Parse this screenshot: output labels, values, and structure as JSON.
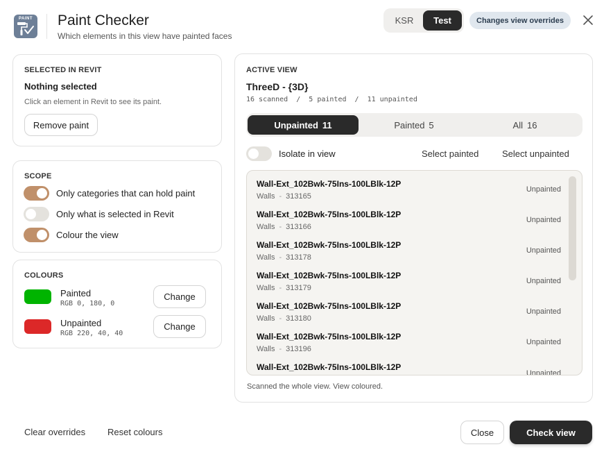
{
  "header": {
    "logo_text": "PAINT",
    "title": "Paint Checker",
    "subtitle": "Which elements in this view have painted faces",
    "env_options": [
      "KSR",
      "Test"
    ],
    "env_active": "Test",
    "overrides_chip": "Changes view overrides",
    "icons": {
      "logo": "paint-roller-check-icon",
      "close": "close-icon"
    }
  },
  "selected": {
    "label": "SELECTED IN REVIT",
    "status": "Nothing selected",
    "hint": "Click an element in Revit to see its paint.",
    "remove_btn": "Remove paint"
  },
  "scope": {
    "label": "SCOPE",
    "options": [
      {
        "label": "Only categories that can hold paint",
        "on": true
      },
      {
        "label": "Only what is selected in Revit",
        "on": false
      },
      {
        "label": "Colour the view",
        "on": true
      }
    ]
  },
  "colours": {
    "label": "COLOURS",
    "items": [
      {
        "name": "Painted",
        "rgb": "RGB 0, 180, 0",
        "color": "#00b400",
        "change_label": "Change"
      },
      {
        "name": "Unpainted",
        "rgb": "RGB 220, 40, 40",
        "color": "#dc2828",
        "change_label": "Change"
      }
    ]
  },
  "active_view": {
    "label": "ACTIVE VIEW",
    "view_name": "ThreeD - {3D}",
    "stats": "16 scanned  /  5 painted  /  11 unpainted",
    "tabs": [
      {
        "label": "Unpainted",
        "count": "11",
        "active": true
      },
      {
        "label": "Painted",
        "count": "5",
        "active": false
      },
      {
        "label": "All",
        "count": "16",
        "active": false
      }
    ],
    "isolate_label": "Isolate in view",
    "isolate_on": false,
    "select_painted": "Select painted",
    "select_unpainted": "Select unpainted",
    "items": [
      {
        "name": "Wall-Ext_102Bwk-75Ins-100LBlk-12P",
        "category": "Walls",
        "id": "313165",
        "status": "Unpainted"
      },
      {
        "name": "Wall-Ext_102Bwk-75Ins-100LBlk-12P",
        "category": "Walls",
        "id": "313166",
        "status": "Unpainted"
      },
      {
        "name": "Wall-Ext_102Bwk-75Ins-100LBlk-12P",
        "category": "Walls",
        "id": "313178",
        "status": "Unpainted"
      },
      {
        "name": "Wall-Ext_102Bwk-75Ins-100LBlk-12P",
        "category": "Walls",
        "id": "313179",
        "status": "Unpainted"
      },
      {
        "name": "Wall-Ext_102Bwk-75Ins-100LBlk-12P",
        "category": "Walls",
        "id": "313180",
        "status": "Unpainted"
      },
      {
        "name": "Wall-Ext_102Bwk-75Ins-100LBlk-12P",
        "category": "Walls",
        "id": "313196",
        "status": "Unpainted"
      },
      {
        "name": "Wall-Ext_102Bwk-75Ins-100LBlk-12P",
        "category": "",
        "id": "",
        "status": "Unpainted"
      }
    ],
    "status_text": "Scanned the whole view. View coloured."
  },
  "footer": {
    "clear_overrides": "Clear overrides",
    "reset_colours": "Reset colours",
    "close": "Close",
    "check_view": "Check view"
  },
  "theme": {
    "accent_toggle": "#c0906a",
    "dark": "#2a2a2a",
    "chip_bg": "#e0e7ee"
  }
}
